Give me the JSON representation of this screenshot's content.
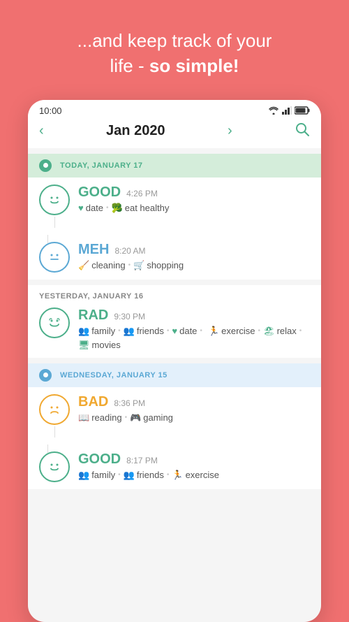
{
  "header": {
    "line1": "...and keep track of your",
    "line2": "life - ",
    "line2_bold": "so simple!"
  },
  "status_bar": {
    "time": "10:00",
    "icons": [
      "wifi",
      "signal",
      "battery"
    ]
  },
  "nav": {
    "prev_arrow": "‹",
    "title": "Jan 2020",
    "next_arrow": "›",
    "search_icon": "🔍"
  },
  "days": [
    {
      "id": "today",
      "label": "TODAY, JANUARY 17",
      "type": "today",
      "entries": [
        {
          "mood": "GOOD",
          "mood_type": "good",
          "time": "4:26 PM",
          "tags": [
            {
              "icon": "♥",
              "icon_color": "green",
              "label": "date"
            },
            {
              "icon": "🥦",
              "icon_color": "green",
              "label": "eat healthy"
            }
          ]
        },
        {
          "mood": "MEH",
          "mood_type": "meh",
          "time": "8:20 AM",
          "tags": [
            {
              "icon": "🧹",
              "icon_color": "teal",
              "label": "cleaning"
            },
            {
              "icon": "🛒",
              "icon_color": "blue",
              "label": "shopping"
            }
          ]
        }
      ]
    },
    {
      "id": "yesterday",
      "label": "YESTERDAY, JANUARY 16",
      "type": "yesterday",
      "entries": [
        {
          "mood": "RAD",
          "mood_type": "rad",
          "time": "9:30 PM",
          "tags": [
            {
              "icon": "👥",
              "icon_color": "teal",
              "label": "family"
            },
            {
              "icon": "👥",
              "icon_color": "teal",
              "label": "friends"
            },
            {
              "icon": "♥",
              "icon_color": "green",
              "label": "date"
            },
            {
              "icon": "🏃",
              "icon_color": "teal",
              "label": "exercise"
            },
            {
              "icon": "🏝",
              "icon_color": "teal",
              "label": "relax"
            },
            {
              "icon": "🖥",
              "icon_color": "teal",
              "label": "movies"
            }
          ]
        }
      ]
    },
    {
      "id": "wednesday",
      "label": "WEDNESDAY, JANUARY 15",
      "type": "wednesday",
      "entries": [
        {
          "mood": "BAD",
          "mood_type": "bad",
          "time": "8:36 PM",
          "tags": [
            {
              "icon": "📖",
              "icon_color": "orange",
              "label": "reading"
            },
            {
              "icon": "🎮",
              "icon_color": "orange",
              "label": "gaming"
            }
          ]
        },
        {
          "mood": "GOOD",
          "mood_type": "good",
          "time": "8:17 PM",
          "tags": [
            {
              "icon": "👥",
              "icon_color": "green",
              "label": "family"
            },
            {
              "icon": "👥",
              "icon_color": "green",
              "label": "friends"
            },
            {
              "icon": "🏃",
              "icon_color": "green",
              "label": "exercise"
            }
          ]
        }
      ]
    }
  ]
}
